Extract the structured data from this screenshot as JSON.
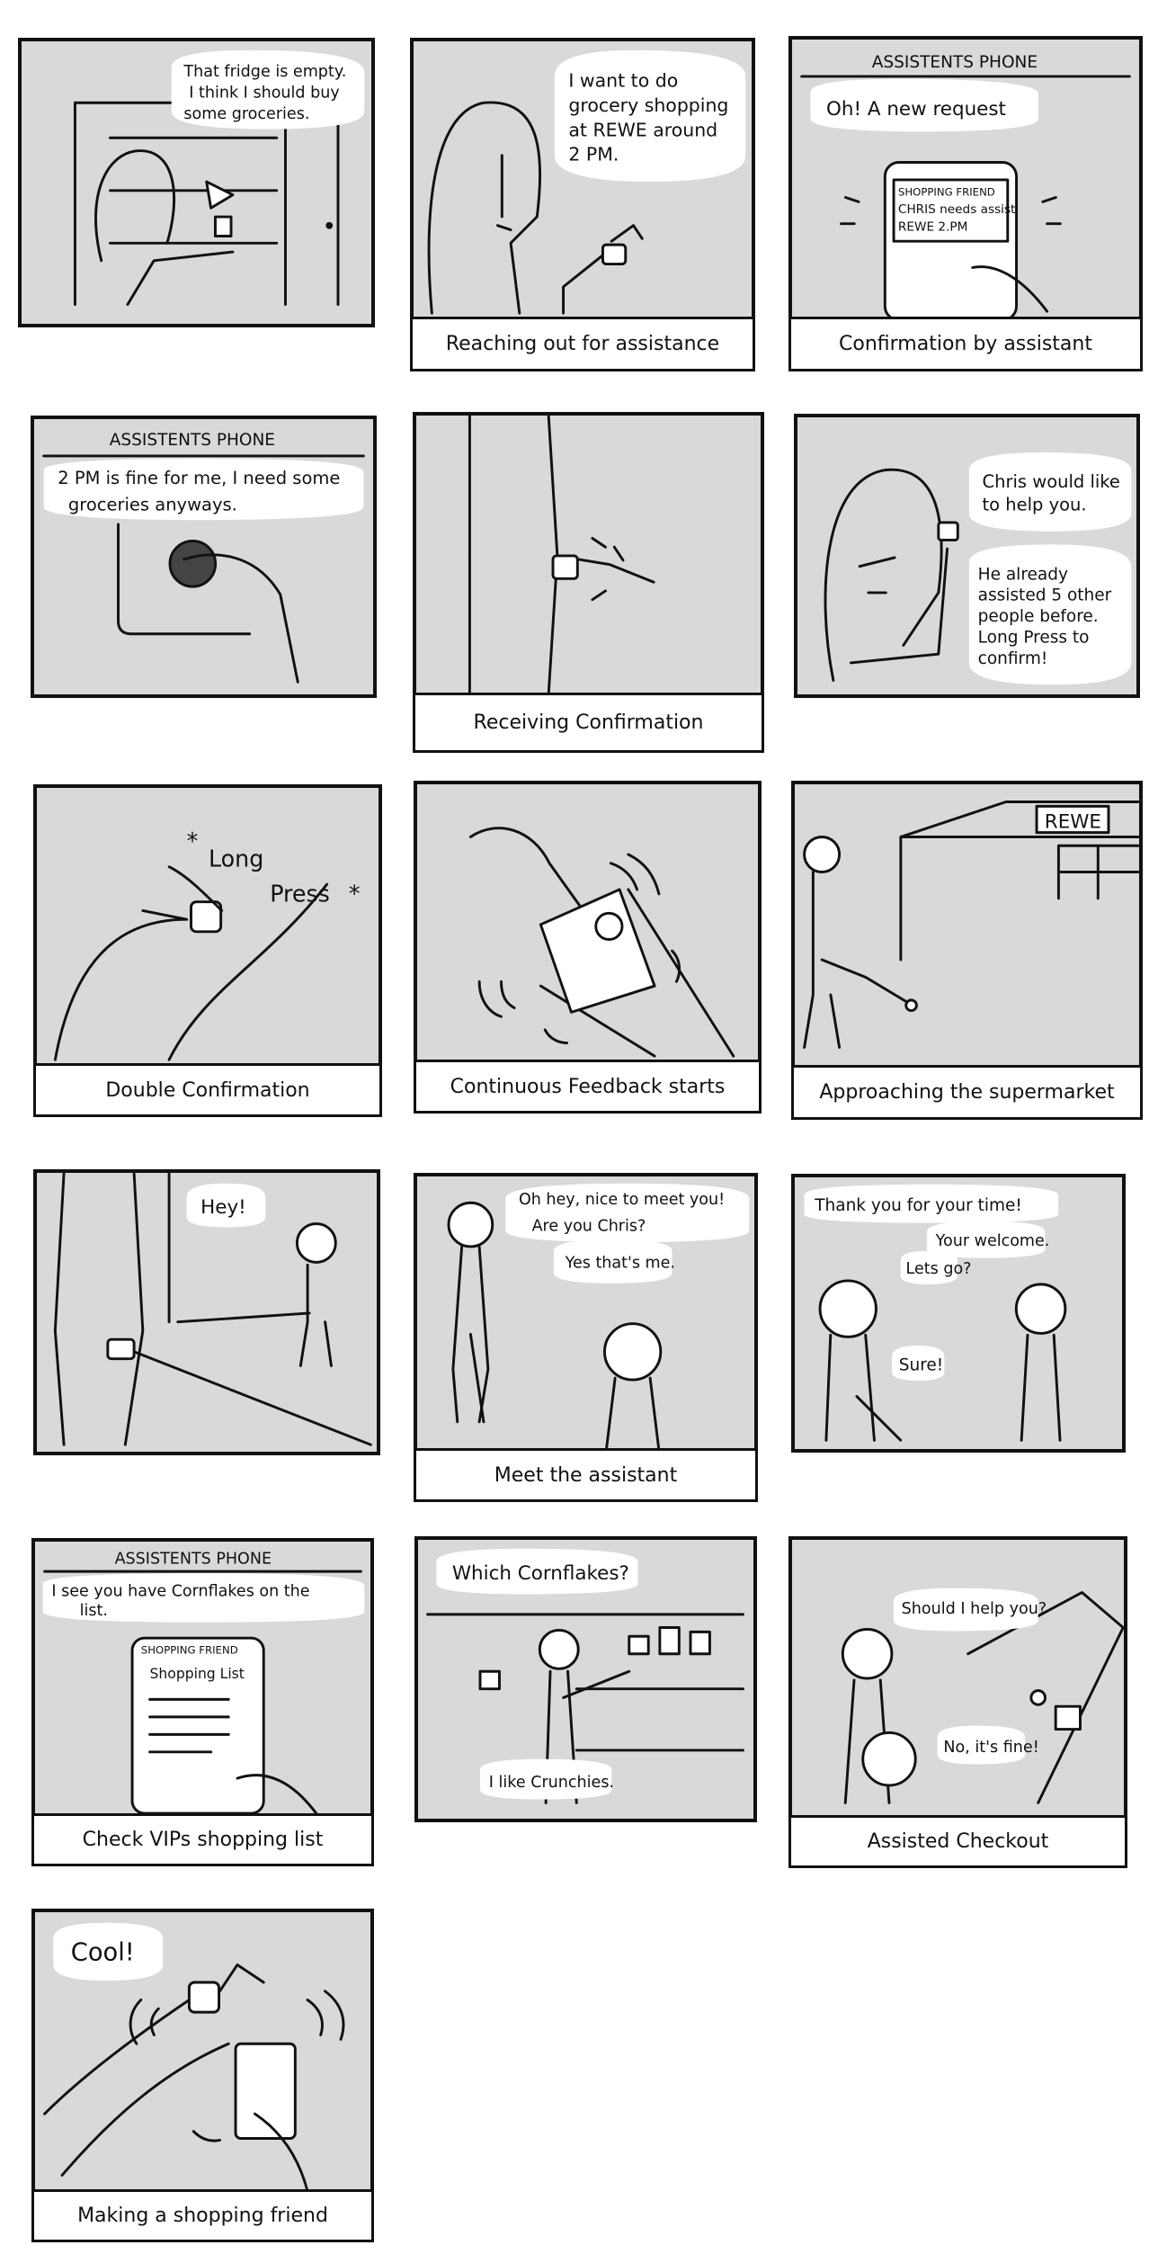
{
  "panels": [
    {
      "caption": "",
      "texts": [
        "That fridge is empty.",
        "I think I should buy",
        "some groceries."
      ]
    },
    {
      "caption": "Reaching out for assistance",
      "texts": [
        "I want to do",
        "grocery shopping",
        "at REWE around",
        "2 PM."
      ]
    },
    {
      "caption": "Confirmation by assistant",
      "texts": [
        "ASSISTENTS PHONE",
        "Oh! A new request",
        "SHOPPING FRIEND",
        "CHRIS needs assist",
        "REWE 2.PM"
      ]
    },
    {
      "caption": "",
      "texts": [
        "ASSISTENTS PHONE",
        "2 PM is fine for me, I need some",
        "groceries anyways."
      ]
    },
    {
      "caption": "Receiving Confirmation",
      "texts": []
    },
    {
      "caption": "",
      "texts": [
        "Chris would like",
        "to help you.",
        "He already",
        "assisted 5 other",
        "people before.",
        "Long Press to",
        "confirm!"
      ]
    },
    {
      "caption": "Double Confirmation",
      "texts": [
        "Long",
        "Press"
      ]
    },
    {
      "caption": "Continuous Feedback starts",
      "texts": []
    },
    {
      "caption": "Approaching the supermarket",
      "texts": [
        "REWE"
      ]
    },
    {
      "caption": "",
      "texts": [
        "Hey!"
      ]
    },
    {
      "caption": "Meet the assistant",
      "texts": [
        "Oh hey, nice to meet you!",
        "Are you Chris?",
        "Yes that's me."
      ]
    },
    {
      "caption": "",
      "texts": [
        "Thank you for your time!",
        "Your welcome.",
        "Lets go?",
        "Sure!"
      ]
    },
    {
      "caption": "Check VIPs shopping list",
      "texts": [
        "ASSISTENTS PHONE",
        "I see you have Cornflakes on the",
        "list.",
        "SHOPPING FRIEND",
        "Shopping List"
      ]
    },
    {
      "caption": "",
      "texts": [
        "Which Cornflakes?",
        "I like Crunchies."
      ]
    },
    {
      "caption": "Assisted Checkout",
      "texts": [
        "Should I help you?",
        "No, it's fine!"
      ]
    },
    {
      "caption": "Making a shopping friend",
      "texts": [
        "Cool!"
      ]
    }
  ]
}
